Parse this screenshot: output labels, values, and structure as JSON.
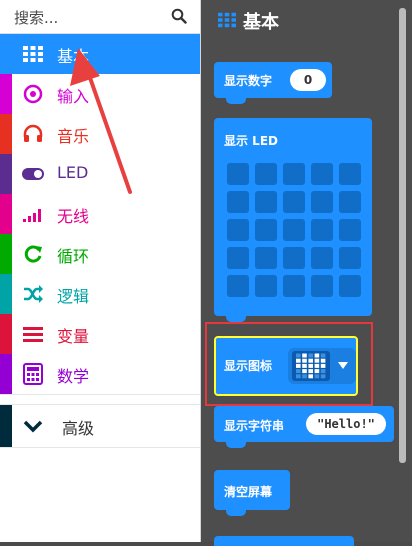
{
  "search": {
    "placeholder": "搜索..."
  },
  "categories": [
    {
      "label": "基本",
      "color": "#1e90ff",
      "icon": "grid-icon"
    },
    {
      "label": "输入",
      "color": "#d400d4",
      "icon": "target-icon"
    },
    {
      "label": "音乐",
      "color": "#e63022",
      "icon": "headphones-icon"
    },
    {
      "label": "LED",
      "color": "#5c2d91",
      "icon": "toggle-icon"
    },
    {
      "label": "无线",
      "color": "#e3008c",
      "icon": "signal-icon"
    },
    {
      "label": "循环",
      "color": "#00aa00",
      "icon": "loop-icon"
    },
    {
      "label": "逻辑",
      "color": "#00a4a6",
      "icon": "shuffle-icon"
    },
    {
      "label": "变量",
      "color": "#dc143c",
      "icon": "list-icon"
    },
    {
      "label": "数学",
      "color": "#9400d3",
      "icon": "calculator-icon"
    }
  ],
  "advanced": {
    "label": "高级",
    "color": "#002b3d"
  },
  "workspace": {
    "title": "基本",
    "blocks": {
      "show_number": {
        "label": "显示数字",
        "value": "0"
      },
      "show_leds": {
        "label": "显示 LED"
      },
      "show_icon": {
        "label": "显示图标"
      },
      "show_string": {
        "label": "显示字符串",
        "value": "\"Hello!\""
      },
      "clear_screen": {
        "label": "清空屏幕"
      }
    }
  },
  "colors": {
    "block": "#1e90ff",
    "selected": "#1e90ff",
    "highlight": "#e4393c",
    "arrow": "#e8403e"
  }
}
